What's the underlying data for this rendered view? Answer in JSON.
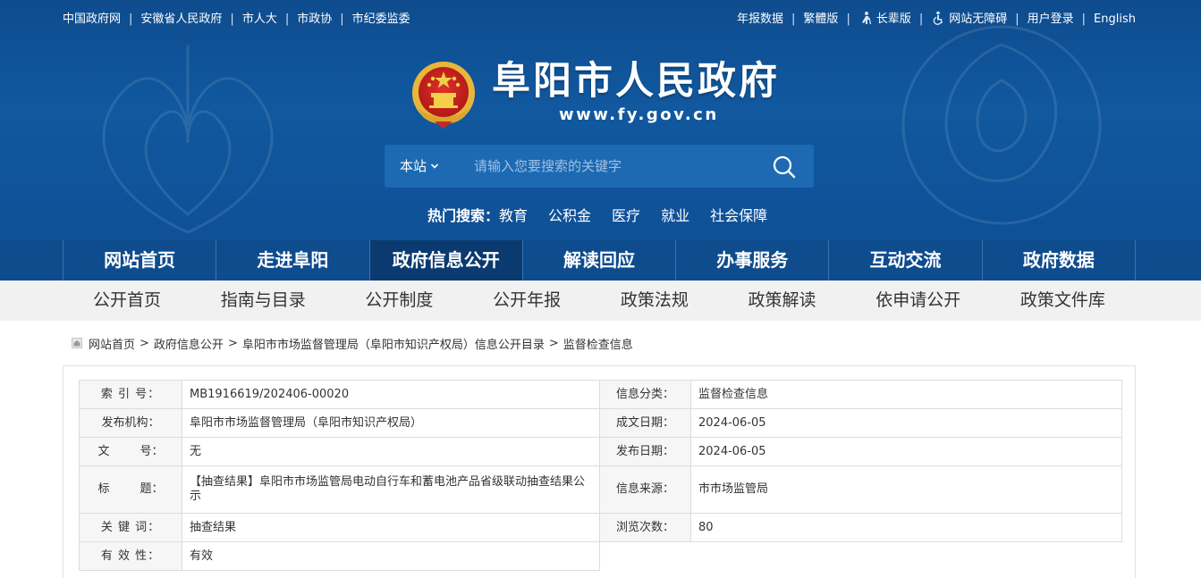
{
  "topbar": {
    "left_links": [
      "中国政府网",
      "安徽省人民政府",
      "市人大",
      "市政协",
      "市纪委监委"
    ],
    "right_links": [
      {
        "label": "年报数据",
        "icon": ""
      },
      {
        "label": "繁體版",
        "icon": ""
      },
      {
        "label": "长辈版",
        "icon": "elder-person-icon"
      },
      {
        "label": "网站无障碍",
        "icon": "accessibility-icon"
      },
      {
        "label": "用户登录",
        "icon": ""
      },
      {
        "label": "English",
        "icon": ""
      }
    ]
  },
  "site": {
    "title": "阜阳市人民政府",
    "url": "www.fy.gov.cn",
    "emblem_icon": "national-emblem-icon"
  },
  "search": {
    "scope": "本站",
    "placeholder": "请输入您要搜索的关键字",
    "button_icon": "search-icon"
  },
  "hot_search": {
    "label": "热门搜索：",
    "items": [
      "教育",
      "公积金",
      "医疗",
      "就业",
      "社会保障"
    ]
  },
  "main_nav": {
    "items": [
      "网站首页",
      "走进阜阳",
      "政府信息公开",
      "解读回应",
      "办事服务",
      "互动交流",
      "政府数据"
    ],
    "active_index": 2
  },
  "sub_nav": {
    "items": [
      "公开首页",
      "指南与目录",
      "公开制度",
      "公开年报",
      "政策法规",
      "政策解读",
      "依申请公开",
      "政策文件库"
    ]
  },
  "breadcrumb": {
    "icon": "home-icon",
    "items": [
      "网站首页",
      "政府信息公开",
      "阜阳市市场监督管理局（阜阳市知识产权局）信息公开目录",
      "监督检查信息"
    ],
    "separator": ">"
  },
  "meta": {
    "index_no_label": "索 引 号：",
    "index_no": "MB1916619/202406-00020",
    "category_label": "信息分类：",
    "category": "监督检查信息",
    "publisher_label": "发布机构：",
    "publisher": "阜阳市市场监督管理局（阜阳市知识产权局）",
    "created_label": "成文日期：",
    "created_date": "2024-06-05",
    "doc_no_label_a": "文",
    "doc_no_label_b": "号：",
    "doc_no": "无",
    "published_label": "发布日期：",
    "published_date": "2024-06-05",
    "title_label_a": "标",
    "title_label_b": "题：",
    "title": "【抽查结果】阜阳市市场监管局电动自行车和蓄电池产品省级联动抽查结果公示",
    "source_label": "信息来源：",
    "source": "市市场监管局",
    "keywords_label": "关 键 词：",
    "keywords": "抽查结果",
    "views_label": "浏览次数：",
    "views": "80",
    "validity_label": "有 效 性：",
    "validity": "有效"
  },
  "colors": {
    "header_blue": "#11589f",
    "nav_blue": "#0e4c8e",
    "nav_active": "#0a3a70",
    "subnav_bg": "#f1f1f1"
  }
}
